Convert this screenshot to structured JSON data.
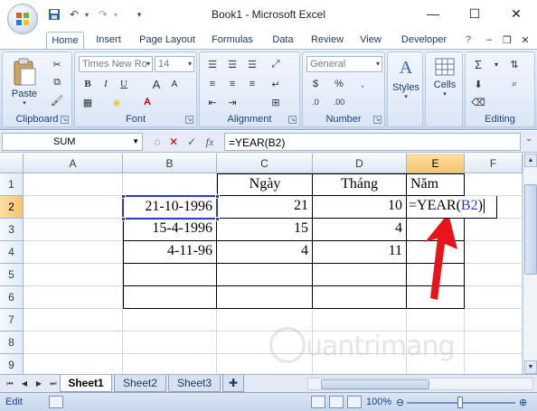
{
  "window": {
    "title": "Book1 - Microsoft Excel"
  },
  "ribbon_tabs": [
    "Home",
    "Insert",
    "Page Layout",
    "Formulas",
    "Data",
    "Review",
    "View",
    "Developer"
  ],
  "ribbon": {
    "clipboard": {
      "paste_label": "Paste",
      "group_label": "Clipboard"
    },
    "font": {
      "font_name": "Times New Ro",
      "font_size": "14",
      "group_label": "Font"
    },
    "alignment": {
      "group_label": "Alignment"
    },
    "number": {
      "format": "General",
      "group_label": "Number"
    },
    "styles": {
      "label": "Styles"
    },
    "cells": {
      "label": "Cells"
    },
    "editing": {
      "group_label": "Editing"
    }
  },
  "formula_bar": {
    "name_box": "SUM",
    "fx": "fx",
    "formula": "=YEAR(B2)"
  },
  "grid": {
    "columns": [
      "A",
      "B",
      "C",
      "D",
      "E",
      "F"
    ],
    "rows": [
      "1",
      "2",
      "3",
      "4",
      "5",
      "6",
      "7",
      "8",
      "9"
    ],
    "selected_column": "E",
    "selected_row": "2",
    "headers_row1": {
      "C": "Ngày",
      "D": "Tháng",
      "E": "Năm"
    },
    "data": [
      {
        "B": "21-10-1996",
        "C": "21",
        "D": "10",
        "E_prefix": "=YEAR(",
        "E_ref": "B2",
        "E_suffix": ")"
      },
      {
        "B": "15-4-1996",
        "C": "15",
        "D": "4"
      },
      {
        "B": "4-11-96",
        "C": "4",
        "D": "11"
      }
    ]
  },
  "sheets": [
    "Sheet1",
    "Sheet2",
    "Sheet3"
  ],
  "active_sheet": "Sheet1",
  "status": {
    "mode": "Edit",
    "zoom": "100%"
  },
  "watermark": "uantrimang",
  "colors": {
    "selection": "#2d3cc8",
    "reference": "#2d3cc8",
    "arrow": "#e8141b",
    "header_selected": "#f7c56d"
  }
}
